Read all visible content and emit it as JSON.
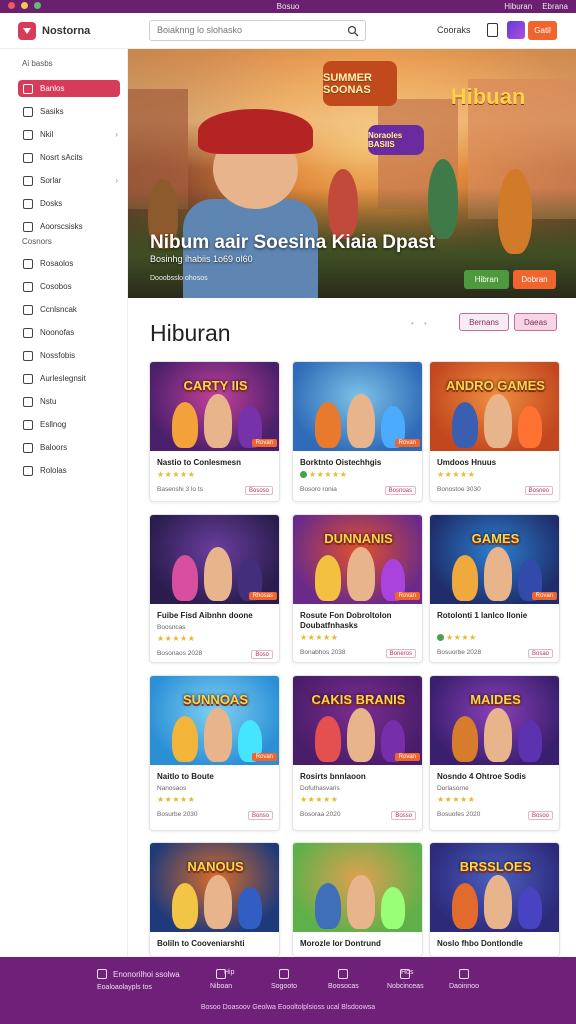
{
  "statusbar": {
    "title": "Bosuo",
    "right_items": [
      "Hiburan",
      "Ebrana"
    ]
  },
  "header": {
    "logo_text": "Nostorna",
    "search_placeholder": "Boiaknng lo slohasko",
    "link": "Cooraks",
    "button": "Gatil"
  },
  "sidebar": {
    "heading1": "Ai basbs",
    "items1": [
      {
        "label": "Banlos",
        "active": true
      },
      {
        "label": "Sasiks"
      },
      {
        "label": "Nkil",
        "chevron": true
      },
      {
        "label": "Nosrt sAcits"
      },
      {
        "label": "Sorlar",
        "chevron": true
      },
      {
        "label": "Dosks"
      },
      {
        "label": "Aoorscsisks"
      }
    ],
    "heading2": "Cosnors",
    "items2": [
      {
        "label": "Rosaolos"
      },
      {
        "label": "Cosobos"
      },
      {
        "label": "Ccnlsncak"
      },
      {
        "label": "Noonofas"
      },
      {
        "label": "Nossfobis"
      },
      {
        "label": "Aurleslegnsit"
      },
      {
        "label": "Nstu"
      },
      {
        "label": "Esllnog"
      },
      {
        "label": "Baloors"
      },
      {
        "label": "Rololas"
      }
    ]
  },
  "hero": {
    "title": "Nibum aair Soesina Kiaia Dpast",
    "subtitle": "Bosinhg ihabiis 1o69 ol60",
    "meta": "Dooobsslo ohosos",
    "sign_left": "SUMMER SOONAS",
    "sign_right": "Hibuan",
    "sign_mid": "Noraoles BASIIS",
    "play_label": "Hibran",
    "more_label": "Dobran"
  },
  "section": {
    "title": "Hiburan",
    "pager": "• •",
    "pill_a": "Bernans",
    "pill_b": "Daeas"
  },
  "cards": [
    {
      "name": "Nastio to Conlesmesn",
      "thumb_title": "CARTY IIS",
      "stars": "★★★★★",
      "meta": "Basenshi 3 lo ts",
      "side": "Bososo",
      "badge": "Rovan",
      "colors": [
        "#4a1f6b",
        "#c2409a",
        "#f2a13b"
      ]
    },
    {
      "name": "Borktnto Oistechhgis",
      "thumb_title": "",
      "stars": "★★★★★",
      "meta": "Bosoro ronia",
      "side": "Bosnoas",
      "badge": "Rovan",
      "dot": true,
      "colors": [
        "#2f6bb8",
        "#7cc3e8",
        "#e77a2c"
      ]
    },
    {
      "name": "Umdoos Hnuus",
      "thumb_title": "ANDRO GAMES",
      "stars": "★★★★★",
      "meta": "Bonostoe 3030",
      "side": "Bosneo",
      "badge": "",
      "colors": [
        "#c2471f",
        "#f08e3e",
        "#3b5fb0"
      ]
    },
    {
      "name": "Fuibe Fisd Aibnhn doone",
      "thumb_title": "",
      "stars": "★★★★★",
      "meta": "Bosonaos 2028",
      "side": "Boso",
      "badge": "Rhosas",
      "sub": "Boosncas",
      "colors": [
        "#2a1d4d",
        "#6b3ea0",
        "#d94fa0"
      ]
    },
    {
      "name": "Rosute Fon Dobroltolon Doubatfnhasks",
      "thumb_title": "DUNNANIS",
      "stars": "★★★★★",
      "meta": "Bonabhos 2038",
      "side": "Boneros",
      "badge": "Rovan",
      "colors": [
        "#6a2a8a",
        "#e0502d",
        "#f4c040"
      ]
    },
    {
      "name": "Rotolonti 1 lanlco llonie",
      "thumb_title": "GAMES",
      "stars": "★★★★",
      "meta": "Bosuorbe 2028",
      "side": "Bosao",
      "badge": "Rovan",
      "dot": true,
      "colors": [
        "#1f2e6a",
        "#2c7fd0",
        "#f0a93c"
      ]
    },
    {
      "name": "Naitlo to Boute",
      "thumb_title": "SUNNOAS",
      "stars": "★★★★★",
      "meta": "Bosurbe 2030",
      "side": "Bonso",
      "badge": "Rovan",
      "sub": "Nanosaos",
      "colors": [
        "#2b8fd6",
        "#7fd0f0",
        "#f2b53a"
      ]
    },
    {
      "name": "Rosirts bnnlaoon",
      "thumb_title": "CAKIS BRANIS",
      "stars": "★★★★★",
      "meta": "Bosoraa 2020",
      "side": "Bosso",
      "badge": "Rovan",
      "sub": "Dofuthasvaris",
      "colors": [
        "#4a1d6a",
        "#7b2d8f",
        "#e44f4f"
      ]
    },
    {
      "name": "Nosndo 4 Ohtroe Sodis",
      "thumb_title": "MAIDES",
      "stars": "★★★★★",
      "meta": "Bosuofes 2020",
      "side": "Bosoo",
      "badge": "",
      "sub": "Dorlasorne",
      "colors": [
        "#3a1f6e",
        "#8a3fb8",
        "#d77c2a"
      ]
    },
    {
      "name": "Boliln to Cooveniarshti",
      "thumb_title": "NANOUS",
      "stars": "",
      "meta": "",
      "side": "",
      "badge": "",
      "colors": [
        "#1f3a7a",
        "#d96c2a",
        "#f2c547"
      ]
    },
    {
      "name": "Morozle lor Dontrund",
      "thumb_title": "",
      "stars": "",
      "meta": "",
      "side": "",
      "badge": "",
      "colors": [
        "#5fb04a",
        "#e0a050",
        "#3e6fb8"
      ]
    },
    {
      "name": "Noslo fhbo Dontlondle",
      "thumb_title": "BRSSLOES",
      "stars": "",
      "meta": "",
      "side": "",
      "badge": "",
      "colors": [
        "#2d2a7a",
        "#4a5fc0",
        "#e26a2c"
      ]
    }
  ],
  "footer": {
    "first_label": "Enonorilhoi ssolwa",
    "first_sub": "Eoaloaolaypls tos",
    "items": [
      {
        "label": "Niboan",
        "top": "Hip"
      },
      {
        "label": "Sogooto"
      },
      {
        "label": "Boosocas"
      },
      {
        "label": "Nobcinceas",
        "top": "Hos"
      },
      {
        "label": "Daoinnoo"
      }
    ],
    "copyright": "Bosoo Doasoov Geolwa Eoooltolplsioss ucal Blsdoowsa"
  },
  "colors": {
    "accent": "#d63b5a",
    "footer": "#6f2079",
    "orange": "#f0652d",
    "green": "#4d9a3c"
  }
}
